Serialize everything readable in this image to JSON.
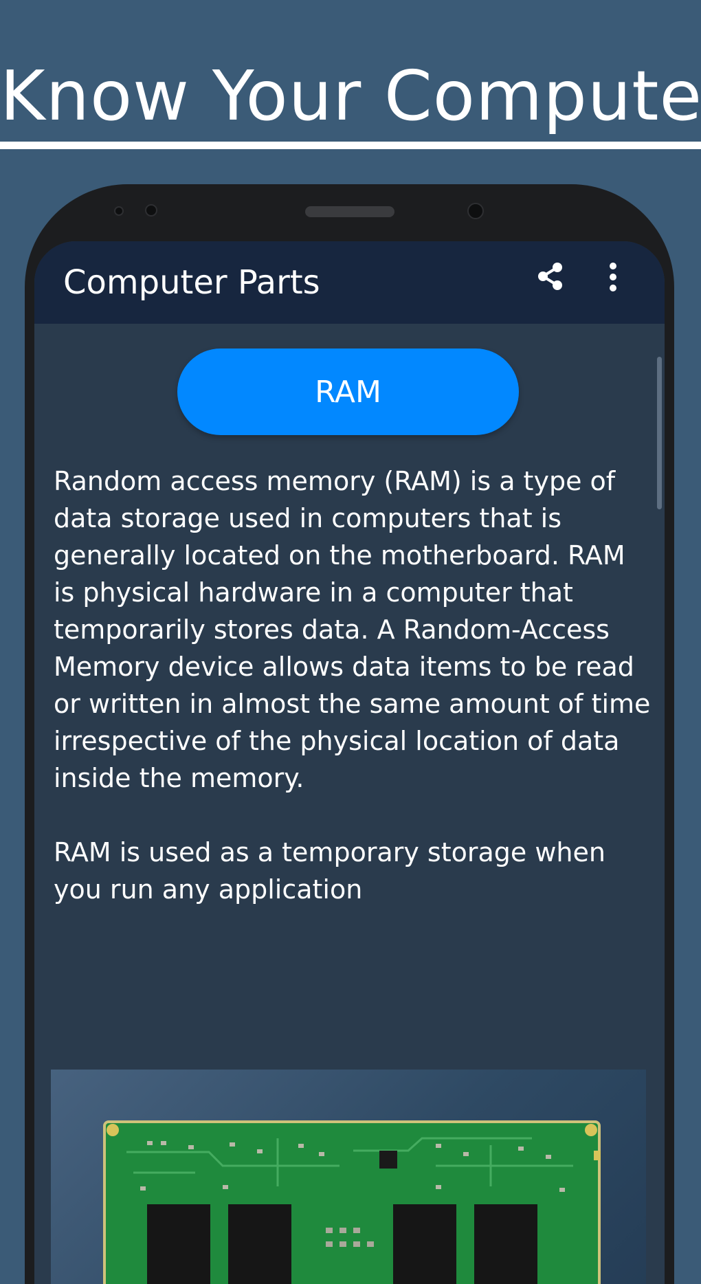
{
  "promo": {
    "title": "Know Your Computer"
  },
  "app": {
    "title": "Computer Parts",
    "share_icon": "share-icon",
    "menu_icon": "more-vert-icon"
  },
  "part": {
    "button_label": "RAM",
    "paragraph_1": "Random access memory (RAM) is a type of data storage used in computers that is generally located on the motherboard. RAM is physical hardware in a computer that temporarily stores data. A Random-Access Memory device allows data items to be read or written in almost the same amount of time irrespective of the physical location of data inside the memory.",
    "paragraph_2": "RAM is used as a temporary storage when you run any application",
    "image_subject": "ram-module-image"
  },
  "colors": {
    "background": "#3b5b77",
    "appbar": "#17263f",
    "screen": "#2a3b4d",
    "button": "#0288ff",
    "pcb_green": "#1f8a3d"
  }
}
